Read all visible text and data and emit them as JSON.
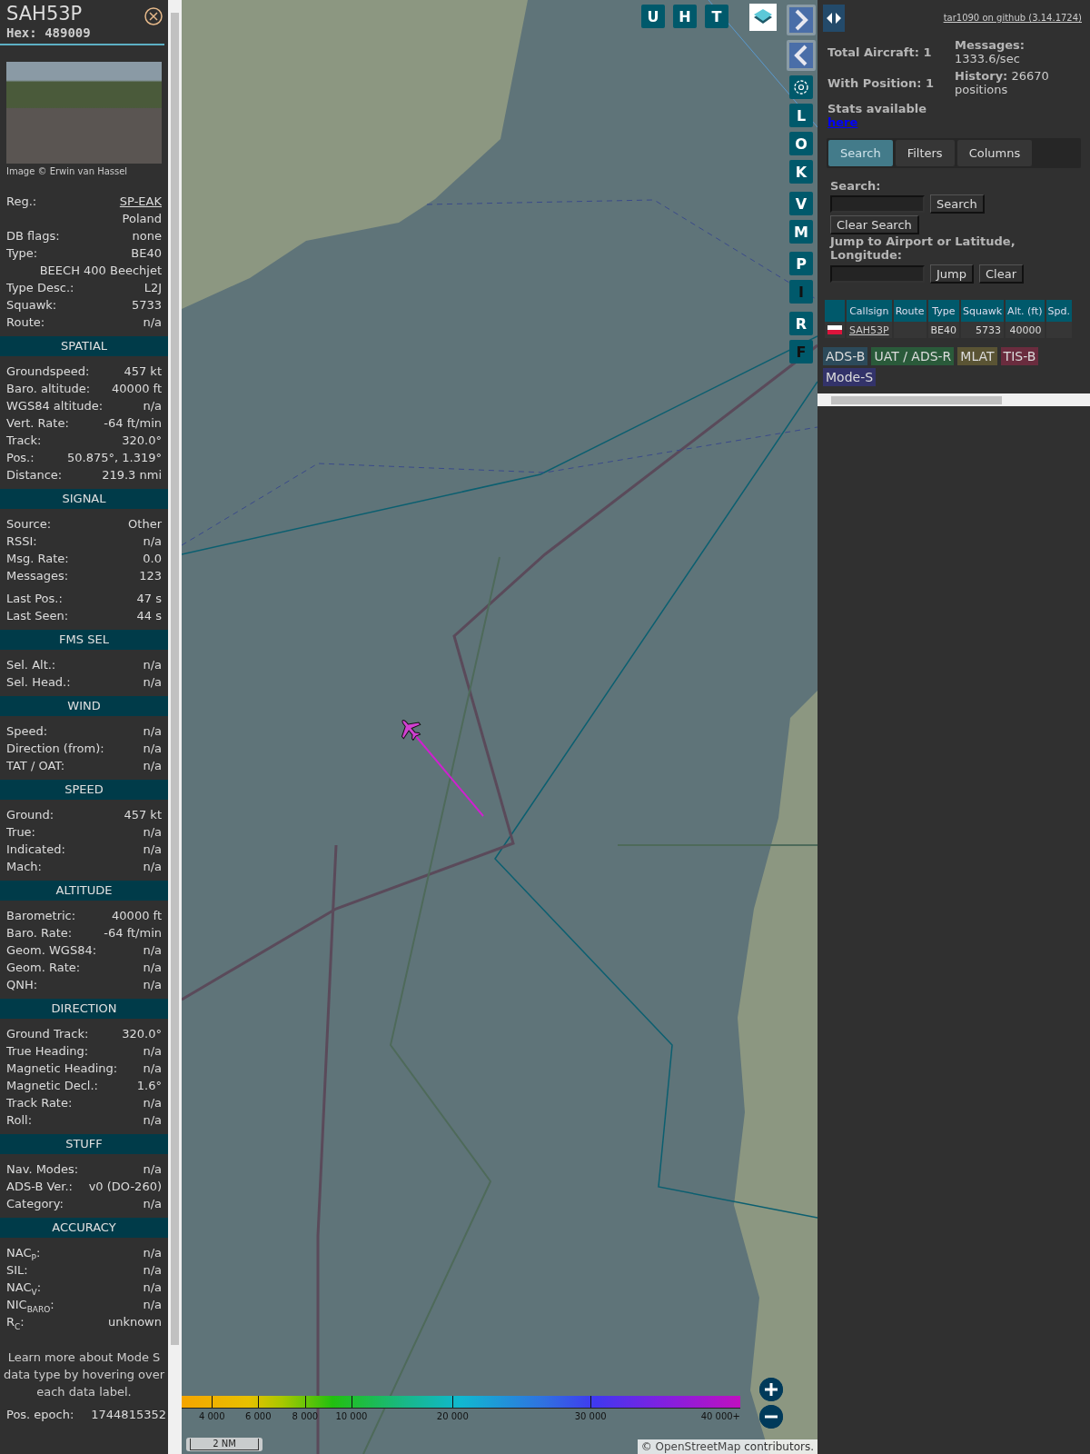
{
  "detail": {
    "callsign": "SAH53P",
    "hex": "Hex: 489009",
    "photo_credit": "Image © Erwin van Hassel",
    "sections": [
      {
        "rows": [
          {
            "label": "Reg.:",
            "value": "SP-EAK",
            "kind": "link"
          },
          {
            "value": "Poland",
            "kind": "plain"
          },
          {
            "label": "DB flags:",
            "value": "none",
            "kind": "plain"
          },
          {
            "label": "Type:",
            "value": "BE40",
            "kind": "plain"
          },
          {
            "value": "BEECH 400 Beechjet",
            "kind": "plain"
          },
          {
            "label": "Type Desc.:",
            "value": "L2J",
            "kind": "plain"
          },
          {
            "label": "Squawk:",
            "value": "5733",
            "kind": "plain"
          },
          {
            "label": "Route:",
            "value": "n/a",
            "kind": "plain"
          }
        ]
      },
      {
        "title": "SPATIAL",
        "rows": [
          {
            "label": "Groundspeed:",
            "value": "457 kt",
            "kind": "plain"
          },
          {
            "label": "Baro. altitude:",
            "value": "40000 ft",
            "kind": "plain"
          },
          {
            "label": "WGS84 altitude:",
            "value": "n/a",
            "kind": "plain"
          },
          {
            "label": "Vert. Rate:",
            "value": "-64 ft/min",
            "kind": "plain"
          },
          {
            "label": "Track:",
            "value": "320.0°",
            "kind": "plain"
          },
          {
            "label": "Pos.:",
            "value": "50.875°, 1.319°",
            "kind": "plain"
          },
          {
            "label": "Distance:",
            "value": "219.3 nmi",
            "kind": "plain"
          }
        ]
      },
      {
        "title": "SIGNAL",
        "rows": [
          {
            "label": "Source:",
            "value": "Other",
            "kind": "plain"
          },
          {
            "label": "RSSI:",
            "value": "n/a",
            "kind": "plain"
          },
          {
            "label": "Msg. Rate:",
            "value": "0.0",
            "kind": "plain"
          },
          {
            "label": "Messages:",
            "value": "123",
            "kind": "plain"
          },
          {
            "label": "Last Pos.:",
            "value": "47 s",
            "kind": "spaced"
          },
          {
            "label": "Last Seen:",
            "value": "44 s",
            "kind": "plain"
          }
        ]
      },
      {
        "title": "FMS SEL",
        "rows": [
          {
            "label": "Sel. Alt.:",
            "value": "n/a",
            "kind": "plain"
          },
          {
            "label": "Sel. Head.:",
            "value": "n/a",
            "kind": "plain"
          }
        ]
      },
      {
        "title": "WIND",
        "rows": [
          {
            "label": "Speed:",
            "value": "n/a",
            "kind": "plain"
          },
          {
            "label": "Direction (from):",
            "value": "n/a",
            "kind": "plain"
          },
          {
            "label": "TAT / OAT:",
            "value": "n/a",
            "kind": "plain"
          }
        ]
      },
      {
        "title": "SPEED",
        "rows": [
          {
            "label": "Ground:",
            "value": "457 kt",
            "kind": "plain"
          },
          {
            "label": "True:",
            "value": "n/a",
            "kind": "plain"
          },
          {
            "label": "Indicated:",
            "value": "n/a",
            "kind": "plain"
          },
          {
            "label": "Mach:",
            "value": "n/a",
            "kind": "plain"
          }
        ]
      },
      {
        "title": "ALTITUDE",
        "rows": [
          {
            "label": "Barometric:",
            "value": "40000 ft",
            "kind": "plain"
          },
          {
            "label": "Baro. Rate:",
            "value": "-64 ft/min",
            "kind": "plain"
          },
          {
            "label": "Geom. WGS84:",
            "value": "n/a",
            "kind": "plain"
          },
          {
            "label": "Geom. Rate:",
            "value": "n/a",
            "kind": "plain"
          },
          {
            "label": "QNH:",
            "value": "n/a",
            "kind": "plain"
          }
        ]
      },
      {
        "title": "DIRECTION",
        "rows": [
          {
            "label": "Ground Track:",
            "value": "320.0°",
            "kind": "plain"
          },
          {
            "label": "True Heading:",
            "value": "n/a",
            "kind": "plain"
          },
          {
            "label": "Magnetic Heading:",
            "value": "n/a",
            "kind": "plain"
          },
          {
            "label": "Magnetic Decl.:",
            "value": "1.6°",
            "kind": "plain"
          },
          {
            "label": "Track Rate:",
            "value": "n/a",
            "kind": "plain"
          },
          {
            "label": "Roll:",
            "value": "n/a",
            "kind": "plain"
          }
        ]
      },
      {
        "title": "STUFF",
        "rows": [
          {
            "label": "Nav. Modes:",
            "value": "n/a",
            "kind": "plain"
          },
          {
            "label": "ADS-B Ver.:",
            "value": "v0 (DO-260)",
            "kind": "plain"
          },
          {
            "label": "Category:",
            "value": "n/a",
            "kind": "plain"
          }
        ]
      },
      {
        "title": "ACCURACY",
        "rows": [
          {
            "label": "NAC$_{P}$:",
            "value": "n/a",
            "kind": "plain"
          },
          {
            "label": "SIL:",
            "value": "n/a",
            "kind": "plain"
          },
          {
            "label": "NAC$_{V}$:",
            "value": "n/a",
            "kind": "plain"
          },
          {
            "label": "NIC$_{BARO}$:",
            "value": "n/a",
            "kind": "plain"
          },
          {
            "label": "R$_{C}$:",
            "value": "unknown",
            "kind": "plain"
          }
        ]
      }
    ],
    "note": "Learn more about Mode S data type by hovering over each data label.",
    "epoch": {
      "label": "Pos. epoch:",
      "value": "1744815352"
    }
  },
  "map": {
    "top_buttons": [
      {
        "label": "U",
        "active": false
      },
      {
        "label": "H",
        "active": false
      },
      {
        "label": "T",
        "active": false
      }
    ],
    "side_button_groups": [
      [
        {
          "label": "L",
          "active": false
        },
        {
          "label": "O",
          "active": false
        },
        {
          "label": "K",
          "active": false
        }
      ],
      [
        {
          "label": "V",
          "active": false
        },
        {
          "label": "M",
          "active": false
        }
      ],
      [
        {
          "label": "P",
          "active": false
        },
        {
          "label": "I",
          "active": true
        }
      ],
      [
        {
          "label": "R",
          "active": false
        },
        {
          "label": "F",
          "active": true
        }
      ]
    ],
    "altitude_legend": [
      "4 000",
      "6 000",
      "8 000",
      "10 000",
      "20 000",
      "30 000",
      "40 000+"
    ],
    "scale": "2 NM",
    "attribution": {
      "prefix": "© ",
      "link": "OpenStreetMap",
      "suffix": " contributors."
    }
  },
  "side": {
    "github_link": "tar1090 on github (3.14.1724)",
    "stats_left": [
      {
        "label": "Total Aircraft:",
        "value": "1"
      },
      {
        "label": "With Position:",
        "value": "1"
      }
    ],
    "stats_right": [
      {
        "label": "Messages:",
        "value": "1333.6/sec"
      },
      {
        "label": "History:",
        "value": "26670 positions"
      }
    ],
    "stats_link": {
      "text": "Stats available",
      "link": "here"
    },
    "tabs": [
      {
        "label": "Search",
        "selected": true
      },
      {
        "label": "Filters",
        "selected": false
      },
      {
        "label": "Columns",
        "selected": false
      }
    ],
    "search": {
      "label": "Search:",
      "button": "Search",
      "clear": "Clear Search"
    },
    "jump": {
      "label": "Jump to Airport or Latitude, Longitude:",
      "button": "Jump",
      "clear": "Clear"
    },
    "table": {
      "columns": [
        "Callsign",
        "Route",
        "Type",
        "Squawk",
        "Alt. (ft)",
        "Spd."
      ],
      "rows": [
        {
          "callsign": "SAH53P",
          "type": "BE40",
          "squawk": "5733",
          "altitude": "40000"
        }
      ]
    },
    "legend": [
      {
        "label": "ADS-B",
        "color": "#2c4a5a"
      },
      {
        "label": "UAT / ADS-R",
        "color": "#2a5a3a"
      },
      {
        "label": "MLAT",
        "color": "#5a5434"
      },
      {
        "label": "TIS-B",
        "color": "#6a2c3e"
      },
      {
        "label": "Mode-S",
        "color": "#33336a"
      }
    ]
  }
}
